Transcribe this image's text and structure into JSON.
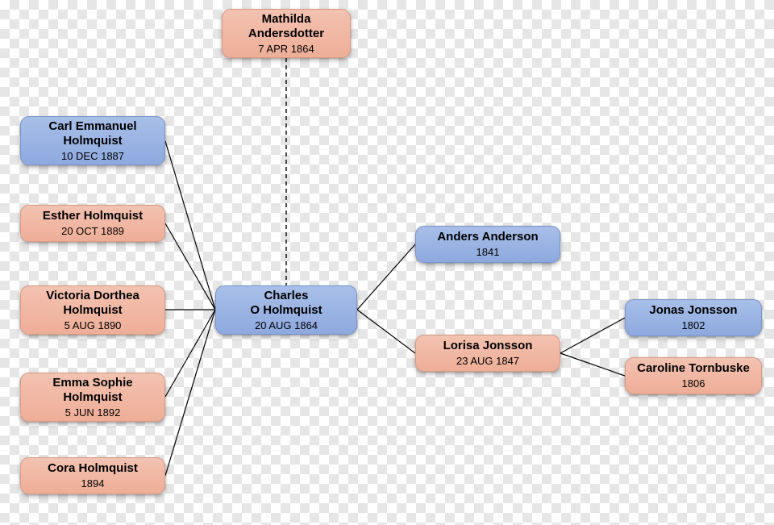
{
  "nodes": {
    "mathilda": {
      "name_line1": "Mathilda",
      "name_line2": "Andersdotter",
      "date": "7 APR 1864",
      "gender": "female"
    },
    "charles": {
      "name_line1": "Charles",
      "name_line2": "O Holmquist",
      "date": "20 AUG 1864",
      "gender": "male"
    },
    "carl": {
      "name_line1": "Carl Emmanuel",
      "name_line2": "Holmquist",
      "date": "10 DEC 1887",
      "gender": "male"
    },
    "esther": {
      "name_line1": "Esther Holmquist",
      "name_line2": "",
      "date": "20 OCT 1889",
      "gender": "female"
    },
    "victoria": {
      "name_line1": "Victoria Dorthea",
      "name_line2": "Holmquist",
      "date": "5 AUG 1890",
      "gender": "female"
    },
    "emma": {
      "name_line1": "Emma Sophie",
      "name_line2": "Holmquist",
      "date": "5 JUN 1892",
      "gender": "female"
    },
    "cora": {
      "name_line1": "Cora Holmquist",
      "name_line2": "",
      "date": "1894",
      "gender": "female"
    },
    "anders": {
      "name_line1": "Anders Anderson",
      "name_line2": "",
      "date": "1841",
      "gender": "male"
    },
    "lorisa": {
      "name_line1": "Lorisa Jonsson",
      "name_line2": "",
      "date": "23 AUG 1847",
      "gender": "female"
    },
    "jonas": {
      "name_line1": "Jonas Jonsson",
      "name_line2": "",
      "date": "1802",
      "gender": "male"
    },
    "caroline": {
      "name_line1": "Caroline Tornbuske",
      "name_line2": "",
      "date": "1806",
      "gender": "female"
    }
  },
  "edges_solid": [
    {
      "from": "charles",
      "to": "carl"
    },
    {
      "from": "charles",
      "to": "esther"
    },
    {
      "from": "charles",
      "to": "victoria"
    },
    {
      "from": "charles",
      "to": "emma"
    },
    {
      "from": "charles",
      "to": "cora"
    },
    {
      "from": "charles",
      "to": "anders"
    },
    {
      "from": "charles",
      "to": "lorisa"
    },
    {
      "from": "lorisa",
      "to": "jonas"
    },
    {
      "from": "lorisa",
      "to": "caroline"
    }
  ],
  "edges_dashed": [
    {
      "from": "charles",
      "to": "mathilda"
    }
  ]
}
